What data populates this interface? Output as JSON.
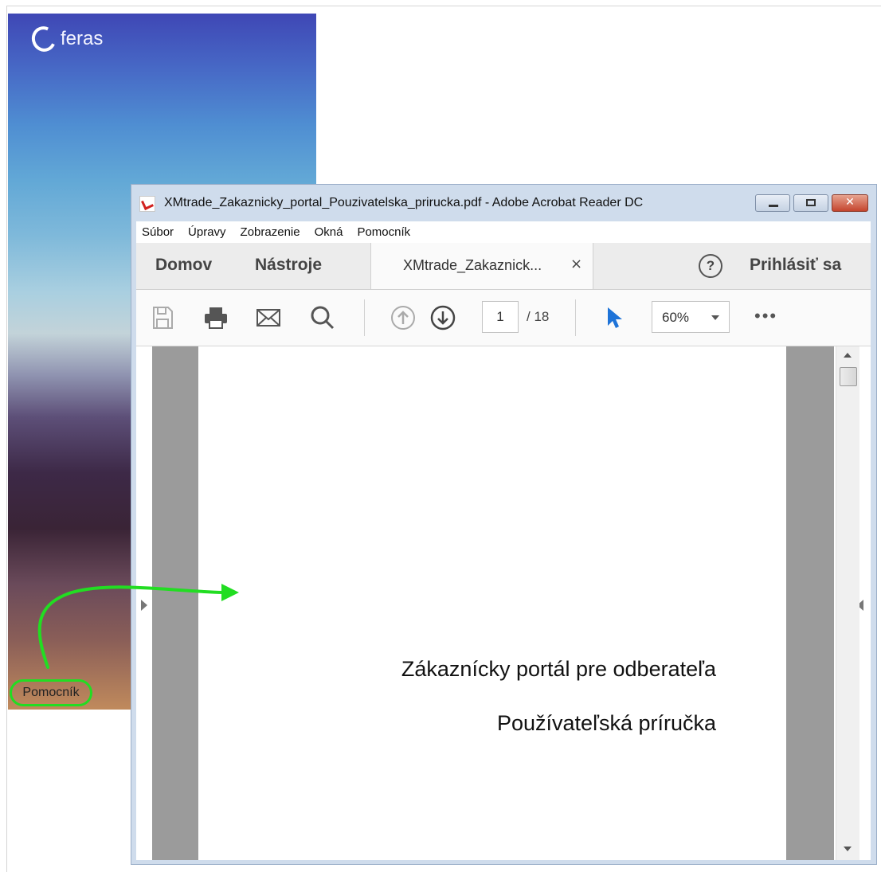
{
  "background_app": {
    "brand": "feras",
    "help_link": "Pomocník"
  },
  "window": {
    "title": "XMtrade_Zakaznicky_portal_Pouzivatelska_prirucka.pdf - Adobe Acrobat Reader DC",
    "icon": "pdf-icon"
  },
  "menu": {
    "items": [
      "Súbor",
      "Úpravy",
      "Zobrazenie",
      "Okná",
      "Pomocník"
    ]
  },
  "tabs": {
    "home": "Domov",
    "tools": "Nástroje",
    "document": "XMtrade_Zakaznick...",
    "close": "×",
    "sign_in": "Prihlásiť sa",
    "help": "?"
  },
  "toolbar": {
    "icons": [
      "save-icon",
      "print-icon",
      "mail-icon",
      "search-icon",
      "page-up-icon",
      "page-down-icon",
      "select-cursor-icon",
      "more-icon"
    ],
    "current_page": "1",
    "total_pages": "/ 18",
    "zoom": "60%",
    "more": "•••"
  },
  "document": {
    "title": "Zákaznícky portál pre odberateľa",
    "subtitle": "Používateľská príručka"
  },
  "colors": {
    "annotation": "#22dd22",
    "cursor_blue": "#1e73d8",
    "page_gutter": "#9b9b9b"
  }
}
